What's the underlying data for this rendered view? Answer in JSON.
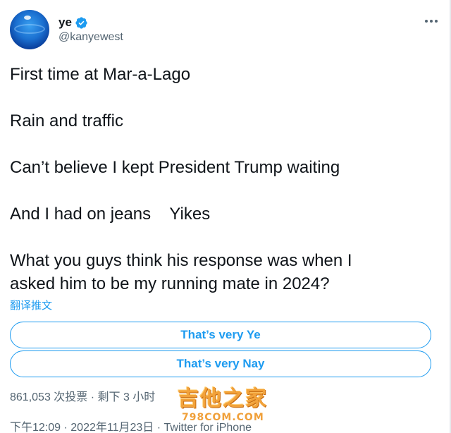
{
  "user": {
    "name": "ye",
    "handle": "@kanyewest"
  },
  "tweet": {
    "lines": [
      "First time at Mar-a-Lago",
      "Rain and traffic",
      "Can’t believe I kept President Trump waiting",
      "And I had on jeans    Yikes",
      "What you guys think his response was when I",
      "asked him to be my running mate in 2024?"
    ],
    "translate_label": "翻译推文"
  },
  "poll": {
    "options": [
      "That’s very Ye",
      "That’s very Nay"
    ],
    "votes": "861,053 次投票",
    "separator": " · ",
    "time_left": "剩下 3 小时"
  },
  "footer": {
    "time": "下午12:09",
    "separator": " · ",
    "date": "2022年11月23日",
    "source": "Twitter for iPhone"
  },
  "watermark": {
    "text": "吉他之家",
    "sub": "798COM.COM"
  },
  "colors": {
    "accent": "#1d9bf0",
    "text": "#0f1419",
    "secondary": "#536471"
  },
  "icons": {
    "verified": "verified-badge-icon",
    "more": "more-horizontal-icon"
  }
}
